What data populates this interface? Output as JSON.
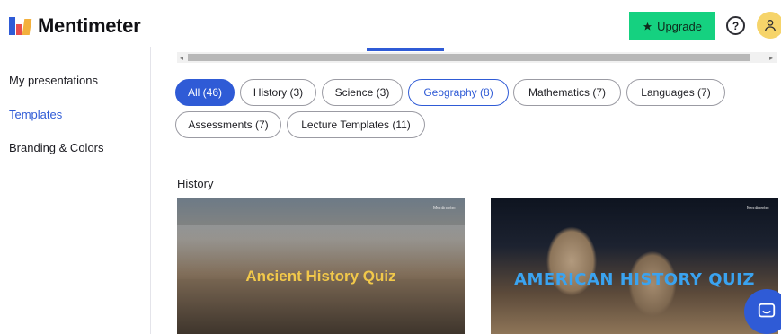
{
  "header": {
    "logo_text": "Mentimeter",
    "upgrade_label": "Upgrade",
    "help_label": "?"
  },
  "sidebar": {
    "items": [
      {
        "label": "My presentations",
        "active": false
      },
      {
        "label": "Templates",
        "active": true
      },
      {
        "label": "Branding & Colors",
        "active": false
      }
    ]
  },
  "filters": [
    {
      "label": "All (46)",
      "state": "selected"
    },
    {
      "label": "History (3)",
      "state": "default"
    },
    {
      "label": "Science (3)",
      "state": "default"
    },
    {
      "label": "Geography (8)",
      "state": "focused"
    },
    {
      "label": "Mathematics (7)",
      "state": "default"
    },
    {
      "label": "Languages (7)",
      "state": "default"
    },
    {
      "label": "Assessments (7)",
      "state": "default"
    },
    {
      "label": "Lecture Templates (11)",
      "state": "default"
    }
  ],
  "section": {
    "title": "History"
  },
  "templates": [
    {
      "title": "Ancient History Quiz",
      "brand": "Mentimeter"
    },
    {
      "title": "AMERICAN HISTORY QUIZ",
      "brand": "Mentimeter"
    }
  ],
  "colors": {
    "accent": "#2f5bd6",
    "upgrade": "#15d180",
    "avatar": "#f6d46a"
  },
  "icons": [
    "star-icon",
    "help-icon",
    "user-icon",
    "chat-icon",
    "scroll-left-arrow-icon",
    "scroll-right-arrow-icon"
  ]
}
